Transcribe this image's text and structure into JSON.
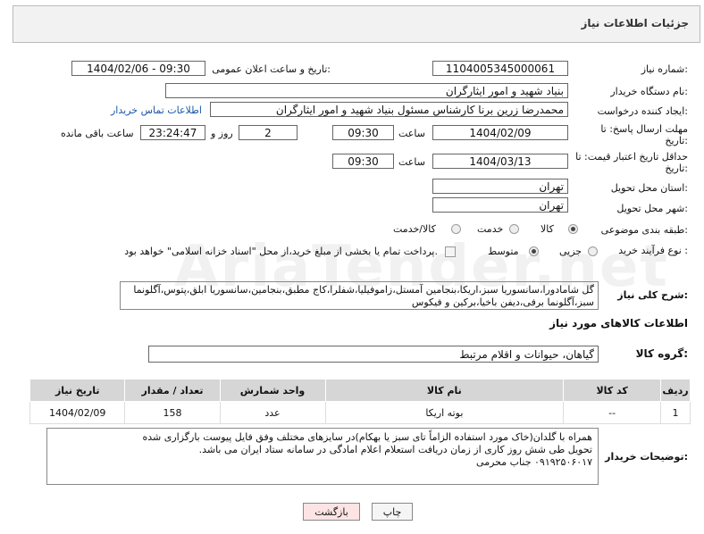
{
  "header": {
    "title": "جزئیات اطلاعات نیاز"
  },
  "fields": {
    "need_number_label": "شماره نیاز:",
    "need_number": "1104005345000061",
    "announce_label": "تاریخ و ساعت اعلان عمومی:",
    "announce_value": "1404/02/06 - 09:30",
    "buyer_org_label": "نام دستگاه خریدار:",
    "buyer_org": "بنیاد شهید و امور ایثارگران",
    "creator_label": "ایجاد کننده درخواست:",
    "creator": "محمدرضا زرین برنا کارشناس مسئول  بنیاد شهید و امور ایثارگران",
    "contact_link": "اطلاعات تماس خریدار",
    "reply_deadline_label": "مهلت ارسال پاسخ: تا تاریخ:",
    "reply_date": "1404/02/09",
    "time_label": "ساعت",
    "reply_time": "09:30",
    "days_value": "2",
    "days_label": "روز و",
    "remaining_time": "23:24:47",
    "remaining_label": "ساعت باقی مانده",
    "price_deadline_label": "حداقل تاریخ اعتبار قیمت: تا تاریخ:",
    "price_date": "1404/03/13",
    "price_time": "09:30",
    "province_label": "استان محل تحویل:",
    "province": "تهران",
    "city_label": "شهر محل تحویل:",
    "city": "تهران",
    "category_label": "طبقه بندی موضوعی:",
    "category_options": [
      "کالا",
      "خدمت",
      "کالا/خدمت"
    ],
    "purchase_type_label": "نوع فرآیند خرید :",
    "purchase_options": [
      "جزیی",
      "متوسط"
    ],
    "payment_note": "پرداخت تمام یا بخشی از مبلغ خرید،از محل \"اسناد خزانه اسلامی\" خواهد بود.",
    "description_label": "شرح کلی نیاز:",
    "description": "گل شامادورا،سانسوریا سبز،اریکا،بنجامین آمستل،زاموفیلیا،شفلرا،کاج مطبق،بنجامین،سانسوریا ابلق،پتوس،آگلونما سبز،آگلونما برفی،دیفن باخیا،برکین و فیکوس"
  },
  "goods": {
    "section_title": "اطلاعات کالاهای مورد نیاز",
    "group_label": "گروه کالا:",
    "group_value": "گیاهان، حیوانات و اقلام مرتبط",
    "columns": [
      "ردیف",
      "کد کالا",
      "نام کالا",
      "واحد شمارش",
      "تعداد / مقدار",
      "تاریخ نیاز"
    ],
    "rows": [
      {
        "row": "1",
        "code": "--",
        "name": "بوته اریکا",
        "unit": "عدد",
        "qty": "158",
        "date": "1404/02/09"
      }
    ]
  },
  "notes": {
    "label": "توضیحات خریدار:",
    "lines": [
      "همراه با گلدان(خاک مورد استفاده الزاماً تای سبز یا بهکام)در سایزهای مختلف وفق فایل پیوست بارگزاری شده",
      "تحویل طی شش روز کاری از زمان دریافت استعلام اعلام امادگی در سامانه ستاد ایران می باشد.",
      "۰۹۱۹۲۵۰۶۰۱۷ جناب محرمی"
    ]
  },
  "buttons": {
    "print": "چاپ",
    "back": "بازگشت"
  },
  "colors": {
    "link": "#1a56a6",
    "header_bg": "#f2f2f2",
    "table_header_bg": "#d6d6d6",
    "back_btn_bg": "#fde4e4"
  }
}
